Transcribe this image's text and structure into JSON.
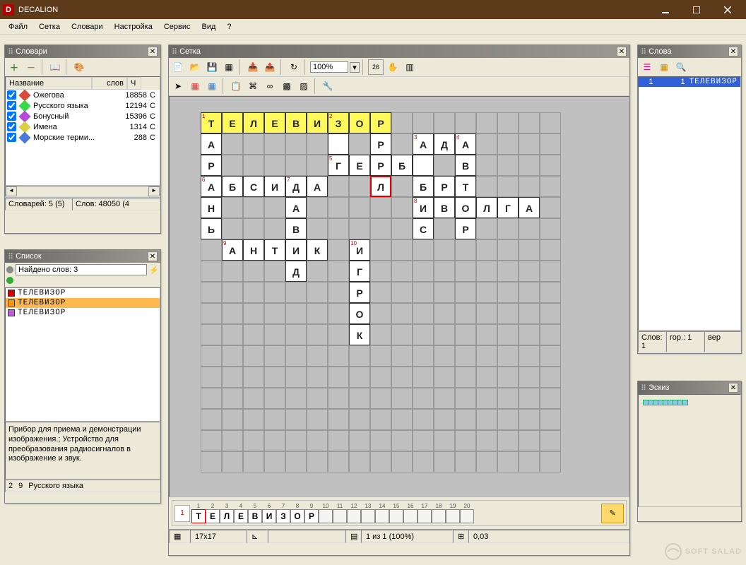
{
  "app": {
    "title": "DECALION",
    "icon_letter": "D"
  },
  "menu": [
    "Файл",
    "Сетка",
    "Словари",
    "Настройка",
    "Сервис",
    "Вид",
    "?"
  ],
  "panels": {
    "dictionaries": {
      "title": "Словари",
      "headers": {
        "name": "Название",
        "words": "слов",
        "c": "Ч"
      },
      "rows": [
        {
          "color": "#D94A3A",
          "name": "Ожегова",
          "count": "18858",
          "c": "С"
        },
        {
          "color": "#3AD94A",
          "name": "Русского языка",
          "count": "12194",
          "c": "С"
        },
        {
          "color": "#B54AD9",
          "name": "Бонусный",
          "count": "15396",
          "c": "С"
        },
        {
          "color": "#D9D04A",
          "name": "Имена",
          "count": "1314",
          "c": "С"
        },
        {
          "color": "#4A7AD9",
          "name": "Морские терми...",
          "count": "288",
          "c": "С"
        }
      ],
      "status": {
        "dicts": "Словарей: 5 (5)",
        "words": "Слов: 48050 (4"
      }
    },
    "list": {
      "title": "Список",
      "found": "Найдено слов: 3",
      "entries": [
        {
          "color": "#D90000",
          "word": "ТЕЛЕВИЗОР",
          "sel": false
        },
        {
          "color": "#FF9A00",
          "word": "ТЕЛЕВИЗОР",
          "sel": true
        },
        {
          "color": "#C060D9",
          "word": "ТЕЛЕВИЗОР",
          "sel": false
        }
      ],
      "definition": "Прибор для приема и демонстрации изображения.; Устройство для преобразования радиосигналов в изображение и звук.",
      "bottom": {
        "a": "2",
        "b": "9",
        "src": "Русского языка"
      }
    },
    "grid": {
      "title": "Сетка",
      "zoom": "100%"
    },
    "words": {
      "title": "Слова",
      "rows": [
        {
          "n": "1",
          "num": "1",
          "word": "ТЕЛЕВИЗОР"
        }
      ],
      "bottom": {
        "count_label": "Слов:",
        "count": "1",
        "hor_label": "гор.:",
        "hor": "1",
        "ver_label": "вер"
      }
    },
    "sketch": {
      "title": "Эскиз",
      "cells": 9
    }
  },
  "grid": {
    "size": 17,
    "cell": 30,
    "highlight_row": 0,
    "highlight_cols": [
      0,
      1,
      2,
      3,
      4,
      5,
      6,
      7,
      8
    ],
    "cursor": {
      "r": 3,
      "c": 8
    },
    "cells": [
      {
        "r": 0,
        "c": 0,
        "l": "Т",
        "n": "1"
      },
      {
        "r": 0,
        "c": 1,
        "l": "Е"
      },
      {
        "r": 0,
        "c": 2,
        "l": "Л"
      },
      {
        "r": 0,
        "c": 3,
        "l": "Е"
      },
      {
        "r": 0,
        "c": 4,
        "l": "В"
      },
      {
        "r": 0,
        "c": 5,
        "l": "И"
      },
      {
        "r": 0,
        "c": 6,
        "l": "З",
        "n": "2"
      },
      {
        "r": 0,
        "c": 7,
        "l": "О"
      },
      {
        "r": 0,
        "c": 8,
        "l": "Р"
      },
      {
        "r": 1,
        "c": 0,
        "l": "А"
      },
      {
        "r": 1,
        "c": 6,
        "l": ""
      },
      {
        "r": 1,
        "c": 8,
        "l": "Р"
      },
      {
        "r": 1,
        "c": 10,
        "l": "А",
        "n": "3"
      },
      {
        "r": 1,
        "c": 11,
        "l": "Д"
      },
      {
        "r": 1,
        "c": 12,
        "l": "А",
        "n": "4"
      },
      {
        "r": 2,
        "c": 0,
        "l": "Р"
      },
      {
        "r": 2,
        "c": 6,
        "l": "Г",
        "n": "5"
      },
      {
        "r": 2,
        "c": 7,
        "l": "Е"
      },
      {
        "r": 2,
        "c": 8,
        "l": "Р"
      },
      {
        "r": 2,
        "c": 9,
        "l": "Б"
      },
      {
        "r": 2,
        "c": 10,
        "l": ""
      },
      {
        "r": 2,
        "c": 12,
        "l": "В"
      },
      {
        "r": 3,
        "c": 0,
        "l": "А",
        "n": "6"
      },
      {
        "r": 3,
        "c": 1,
        "l": "Б"
      },
      {
        "r": 3,
        "c": 2,
        "l": "С"
      },
      {
        "r": 3,
        "c": 3,
        "l": "И"
      },
      {
        "r": 3,
        "c": 4,
        "l": "Д",
        "n": "7"
      },
      {
        "r": 3,
        "c": 5,
        "l": "А"
      },
      {
        "r": 3,
        "c": 8,
        "l": "Л"
      },
      {
        "r": 3,
        "c": 10,
        "l": "Б"
      },
      {
        "r": 3,
        "c": 11,
        "l": "Р"
      },
      {
        "r": 3,
        "c": 12,
        "l": "Т"
      },
      {
        "r": 4,
        "c": 0,
        "l": "Н"
      },
      {
        "r": 4,
        "c": 4,
        "l": "А"
      },
      {
        "r": 4,
        "c": 10,
        "l": "И",
        "n": "8"
      },
      {
        "r": 4,
        "c": 11,
        "l": "В"
      },
      {
        "r": 4,
        "c": 12,
        "l": "О"
      },
      {
        "r": 4,
        "c": 13,
        "l": "Л"
      },
      {
        "r": 4,
        "c": 14,
        "l": "Г"
      },
      {
        "r": 4,
        "c": 15,
        "l": "А"
      },
      {
        "r": 5,
        "c": 0,
        "l": "Ь"
      },
      {
        "r": 5,
        "c": 4,
        "l": "В"
      },
      {
        "r": 5,
        "c": 10,
        "l": "С"
      },
      {
        "r": 5,
        "c": 12,
        "l": "Р"
      },
      {
        "r": 6,
        "c": 1,
        "l": "А",
        "n": "9"
      },
      {
        "r": 6,
        "c": 2,
        "l": "Н"
      },
      {
        "r": 6,
        "c": 3,
        "l": "Т"
      },
      {
        "r": 6,
        "c": 4,
        "l": "И"
      },
      {
        "r": 6,
        "c": 5,
        "l": "К"
      },
      {
        "r": 6,
        "c": 7,
        "l": "И",
        "n": "10"
      },
      {
        "r": 7,
        "c": 4,
        "l": "Д"
      },
      {
        "r": 7,
        "c": 7,
        "l": "Г"
      },
      {
        "r": 8,
        "c": 7,
        "l": "Р"
      },
      {
        "r": 9,
        "c": 7,
        "l": "О"
      },
      {
        "r": 10,
        "c": 7,
        "l": "К"
      }
    ]
  },
  "entry": {
    "num": "1",
    "positions": [
      "1",
      "2",
      "3",
      "4",
      "5",
      "6",
      "7",
      "8",
      "9",
      "10",
      "11",
      "12",
      "13",
      "14",
      "15",
      "16",
      "17",
      "18",
      "19",
      "20"
    ],
    "letters": [
      "Т",
      "Е",
      "Л",
      "Е",
      "В",
      "И",
      "З",
      "О",
      "Р",
      "",
      "",
      "",
      "",
      "",
      "",
      "",
      "",
      "",
      "",
      ""
    ]
  },
  "status": {
    "size": "17x17",
    "page": "1 из 1 (100%)",
    "density": "0,03"
  },
  "watermark": "SOFT SALAD"
}
